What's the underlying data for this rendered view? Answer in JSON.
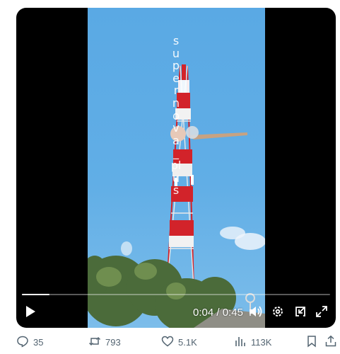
{
  "video": {
    "watermark": "supernova_plus",
    "current_time": "0:04",
    "separator": " / ",
    "duration": "0:45",
    "progress": 0.089
  },
  "actions": {
    "replies": "35",
    "reposts": "793",
    "likes": "5.1K",
    "views": "113K"
  },
  "icons": [
    "play-icon",
    "volume-icon",
    "settings-gear-icon",
    "exit-icon",
    "fullscreen-icon",
    "reply-icon",
    "repost-icon",
    "like-icon",
    "views-icon",
    "bookmark-icon",
    "share-icon"
  ],
  "colors": {
    "action_gray": "#536471",
    "tower_red": "#d2232a",
    "sky_blue": "#61aee6"
  }
}
